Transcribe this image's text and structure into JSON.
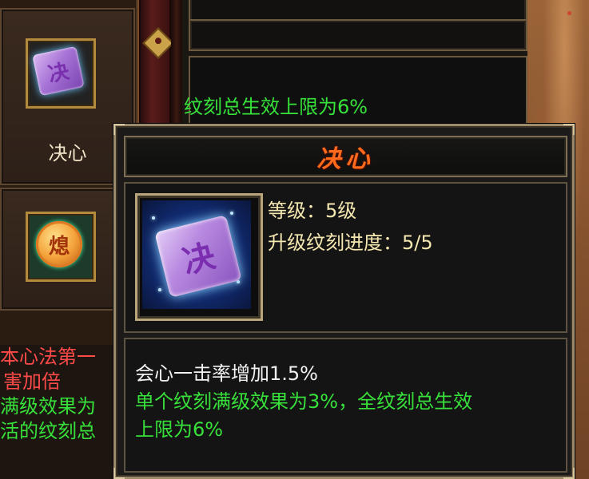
{
  "colors": {
    "title": "#ff6a1c",
    "info_text": "#f5e7b0",
    "green_text": "#37e03a",
    "white_text": "#f2f2f2",
    "left_red": "#ff4a4a",
    "left_green": "#37e03a"
  },
  "left_panel": {
    "skill_1": {
      "label": "决心",
      "gem_char": "决",
      "icon": "jue-xin-gem-icon"
    },
    "skill_2": {
      "gem_char": "熄",
      "icon": "xi-gem-icon"
    },
    "text_lines": [
      "本心法第一",
      "害加倍",
      "满级效果为",
      "活的纹刻总"
    ]
  },
  "background_panel": {
    "green_text": "纹刻总生效上限为6%"
  },
  "tooltip": {
    "title": "决心",
    "icon": "jue-xin-gem-icon",
    "gem_char": "决",
    "level_line": "等级：5级",
    "progress_line": "升级纹刻进度：5/5",
    "effect_line": "会心一击率增加1.5%",
    "note_line_1": "单个纹刻满级效果为3%，全纹刻总生效",
    "note_line_2": "上限为6%"
  }
}
